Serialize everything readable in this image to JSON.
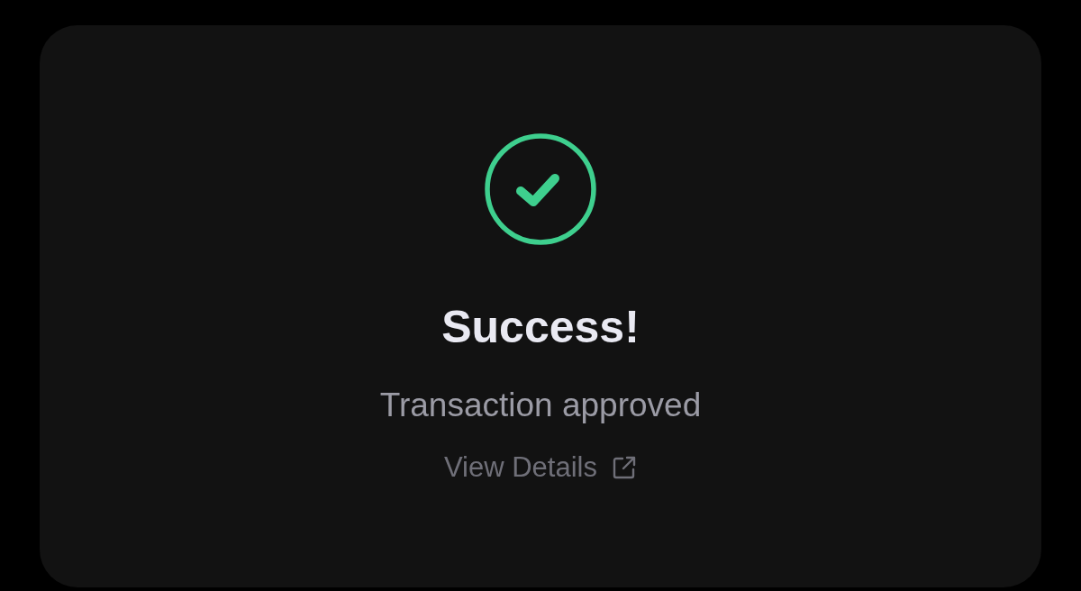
{
  "status": {
    "kind": "success",
    "title": "Success!",
    "message": "Transaction approved"
  },
  "link": {
    "label": "View Details"
  }
}
